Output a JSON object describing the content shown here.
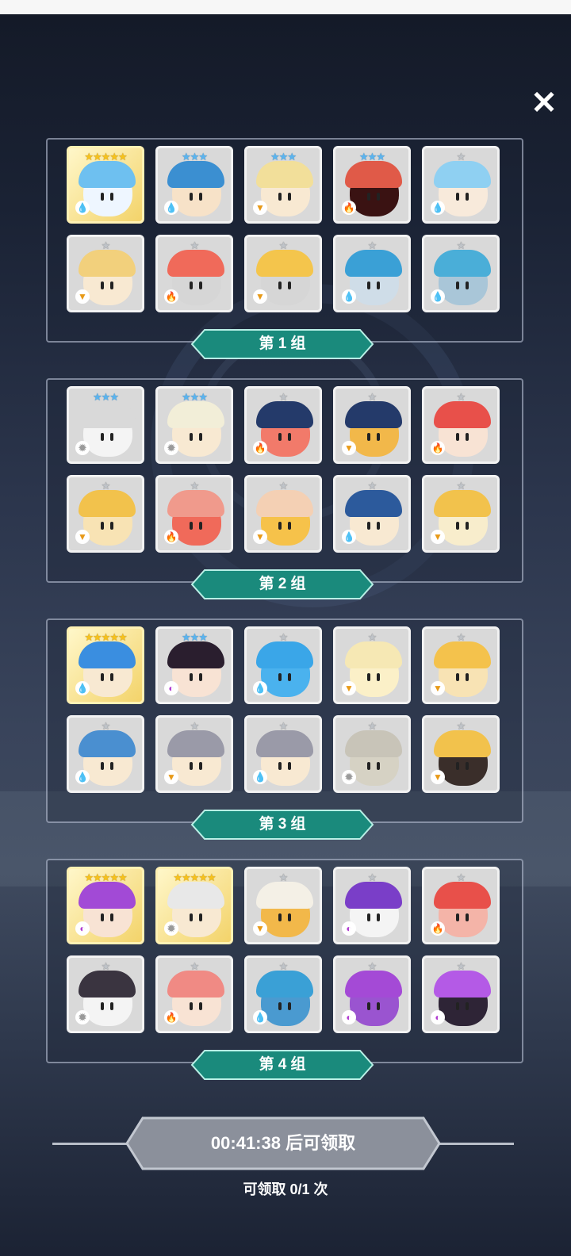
{
  "close_label": "✕",
  "groups": [
    {
      "label": "第 1 组",
      "cards": [
        {
          "stars": "★★★★★",
          "tier": "gold",
          "element": "water",
          "hair": "#6ec0f0",
          "face": "#eef6ff"
        },
        {
          "stars": "★★★",
          "tier": "blue",
          "element": "water",
          "hair": "#3b8fd1",
          "face": "#f7e2c8"
        },
        {
          "stars": "★★★",
          "tier": "blue",
          "element": "earth",
          "hair": "#f2df9a",
          "face": "#f8e9d2"
        },
        {
          "stars": "★★★",
          "tier": "blue",
          "element": "fire",
          "hair": "#e05a48",
          "face": "#3a1212"
        },
        {
          "stars": "★",
          "tier": "silver",
          "element": "water",
          "hair": "#8fd0f2",
          "face": "#f8eadb"
        },
        {
          "stars": "★",
          "tier": "silver",
          "element": "earth",
          "hair": "#f2d07c",
          "face": "#f8e9d2"
        },
        {
          "stars": "★",
          "tier": "silver",
          "element": "fire",
          "hair": "#f06a5a",
          "face": "#d6d6d6"
        },
        {
          "stars": "★",
          "tier": "silver",
          "element": "earth",
          "hair": "#f4c54c",
          "face": "#d6d6d6"
        },
        {
          "stars": "★",
          "tier": "silver",
          "element": "water",
          "hair": "#3aa0d6",
          "face": "#cfdde8"
        },
        {
          "stars": "★",
          "tier": "silver",
          "element": "water",
          "hair": "#4aaed8",
          "face": "#a9c6d8"
        }
      ]
    },
    {
      "label": "第 2 组",
      "cards": [
        {
          "stars": "★★★",
          "tier": "blue",
          "element": "light",
          "hair": "#d9d9d9",
          "face": "#f4f4f4"
        },
        {
          "stars": "★★★",
          "tier": "blue",
          "element": "light",
          "hair": "#f2eed8",
          "face": "#f8e9d2"
        },
        {
          "stars": "★",
          "tier": "silver",
          "element": "fire",
          "hair": "#243a6a",
          "face": "#f27a6a"
        },
        {
          "stars": "★",
          "tier": "silver",
          "element": "earth",
          "hair": "#243a6a",
          "face": "#f2b84a"
        },
        {
          "stars": "★",
          "tier": "silver",
          "element": "fire",
          "hair": "#e8504a",
          "face": "#f8e3d4"
        },
        {
          "stars": "★",
          "tier": "silver",
          "element": "earth",
          "hair": "#f2c24c",
          "face": "#f8e3b4"
        },
        {
          "stars": "★",
          "tier": "silver",
          "element": "fire",
          "hair": "#f09a8c",
          "face": "#f06a5a"
        },
        {
          "stars": "★",
          "tier": "silver",
          "element": "earth",
          "hair": "#f4d0b4",
          "face": "#f6c24a"
        },
        {
          "stars": "★",
          "tier": "silver",
          "element": "water",
          "hair": "#2c5a9c",
          "face": "#f8e9d2"
        },
        {
          "stars": "★",
          "tier": "silver",
          "element": "earth",
          "hair": "#f2c24c",
          "face": "#f8edcc"
        }
      ]
    },
    {
      "label": "第 3 组",
      "cards": [
        {
          "stars": "★★★★★",
          "tier": "gold",
          "element": "water",
          "hair": "#3a8ee0",
          "face": "#f8e9d2"
        },
        {
          "stars": "★★★",
          "tier": "blue",
          "element": "dark",
          "hair": "#2a1e2e",
          "face": "#f8e3d4"
        },
        {
          "stars": "★",
          "tier": "silver",
          "element": "water",
          "hair": "#3aa6e8",
          "face": "#4ab2ee"
        },
        {
          "stars": "★",
          "tier": "silver",
          "element": "earth",
          "hair": "#f6e8b4",
          "face": "#fbf0c8"
        },
        {
          "stars": "★",
          "tier": "silver",
          "element": "earth",
          "hair": "#f4c24c",
          "face": "#f8e3b4"
        },
        {
          "stars": "★",
          "tier": "silver",
          "element": "water",
          "hair": "#4a8fd0",
          "face": "#f8e9d2"
        },
        {
          "stars": "★",
          "tier": "silver",
          "element": "earth",
          "hair": "#9a9aa8",
          "face": "#f8e9d2"
        },
        {
          "stars": "★",
          "tier": "silver",
          "element": "water",
          "hair": "#9a9aa8",
          "face": "#f8e9d2"
        },
        {
          "stars": "★",
          "tier": "silver",
          "element": "light",
          "hair": "#c8c4b8",
          "face": "#d6d2c4"
        },
        {
          "stars": "★",
          "tier": "silver",
          "element": "earth",
          "hair": "#f2c24c",
          "face": "#3a2e2a"
        }
      ]
    },
    {
      "label": "第 4 组",
      "cards": [
        {
          "stars": "★★★★★",
          "tier": "gold",
          "element": "dark",
          "hair": "#a24ad6",
          "face": "#f8e3d4"
        },
        {
          "stars": "★★★★★",
          "tier": "gold",
          "element": "light",
          "hair": "#e8e8e8",
          "face": "#f8e9d2"
        },
        {
          "stars": "★",
          "tier": "silver",
          "element": "earth",
          "hair": "#f4f0e6",
          "face": "#f2b84a"
        },
        {
          "stars": "★",
          "tier": "silver",
          "element": "dark",
          "hair": "#7a3ec8",
          "face": "#f4f4f4"
        },
        {
          "stars": "★",
          "tier": "silver",
          "element": "fire",
          "hair": "#e8504a",
          "face": "#f4b4a8"
        },
        {
          "stars": "★",
          "tier": "silver",
          "element": "light",
          "hair": "#3a3440",
          "face": "#f4f4f4"
        },
        {
          "stars": "★",
          "tier": "silver",
          "element": "fire",
          "hair": "#f08a84",
          "face": "#f8e3d4"
        },
        {
          "stars": "★",
          "tier": "silver",
          "element": "water",
          "hair": "#3aa0d6",
          "face": "#4a9ad0"
        },
        {
          "stars": "★",
          "tier": "silver",
          "element": "dark",
          "hair": "#a44ad6",
          "face": "#9a54d0"
        },
        {
          "stars": "★",
          "tier": "silver",
          "element": "dark",
          "hair": "#b45ae6",
          "face": "#2e2436"
        }
      ]
    }
  ],
  "timer_text": "00:41:38 后可领取",
  "claim_count_text": "可领取 0/1 次",
  "colors": {
    "label_bar": "#1a8a7c",
    "timer_box": "#8c929e"
  }
}
